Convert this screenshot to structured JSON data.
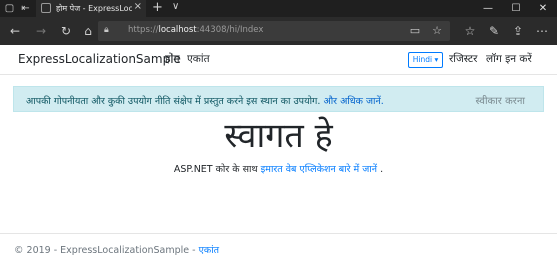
{
  "browser": {
    "tab_title": "होम पेज - ExpressLocaliz",
    "new_tab": "+",
    "tab_overflow": "∨",
    "url_prefix": "https://",
    "url_host": "localhost",
    "url_rest": ":44308/hi/Index"
  },
  "app": {
    "brand": "ExpressLocalizationSample",
    "nav": {
      "home": "होम",
      "privacy": "एकांत"
    },
    "language": "Hindi",
    "register": "रजिस्टर",
    "login": "लॉग इन करें"
  },
  "cookie": {
    "text": "आपकी गोपनीयता और कुकी उपयोग नीति संक्षेप में प्रस्तुत करने इस स्थान का उपयोग.",
    "link": "और अधिक जानें.",
    "accept": "स्वीकार करना"
  },
  "main": {
    "title": "स्वागत हे",
    "learn_prefix": "ASP.NET कोर के साथ",
    "learn_link": "इमारत वेब एप्लिकेशन बारे में जानें",
    "learn_suffix": "."
  },
  "footer": {
    "text": "© 2019 - ExpressLocalizationSample -",
    "link": "एकांत"
  },
  "colors": {
    "link": "#007bff",
    "alert_bg": "#d1ecf1",
    "alert_text": "#0c5460",
    "browser_dark": "#2b2b2b"
  }
}
